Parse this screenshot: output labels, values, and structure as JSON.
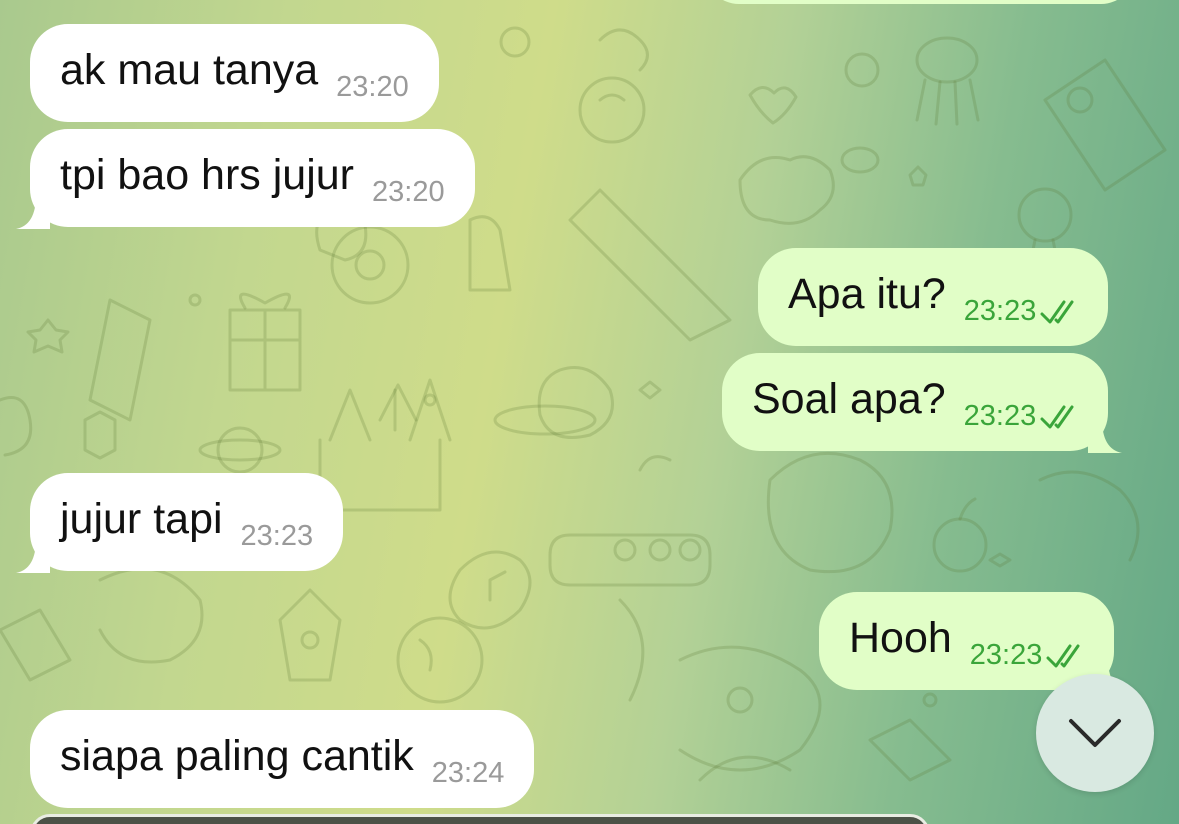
{
  "chat": {
    "messages": [
      {
        "direction": "incoming",
        "text": "ak mau tanya",
        "time": "23:20"
      },
      {
        "direction": "incoming",
        "text": "tpi bao hrs jujur",
        "time": "23:20"
      },
      {
        "direction": "outgoing",
        "text": "Apa itu?",
        "time": "23:23",
        "status": "read"
      },
      {
        "direction": "outgoing",
        "text": "Soal apa?",
        "time": "23:23",
        "status": "read"
      },
      {
        "direction": "incoming",
        "text": "jujur tapi",
        "time": "23:23"
      },
      {
        "direction": "outgoing",
        "text": "Hooh",
        "time": "23:23",
        "status": "read"
      },
      {
        "direction": "incoming",
        "text": "siapa paling cantik",
        "time": "23:24"
      }
    ]
  },
  "controls": {
    "scroll_down_icon": "chevron-down-icon",
    "read_status_icon": "double-check-icon"
  },
  "colors": {
    "incoming_bubble": "#ffffff",
    "outgoing_bubble": "#e1fec7",
    "outgoing_time": "#3aa53a",
    "incoming_time": "#9a9a9a"
  }
}
